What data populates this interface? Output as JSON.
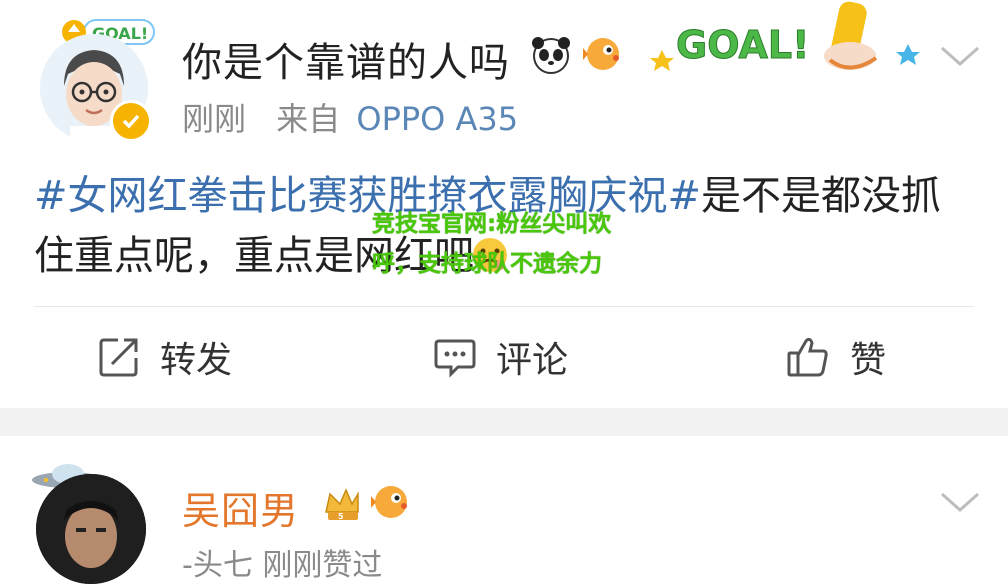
{
  "post": {
    "author_name": "你是个靠谱的人吗",
    "time": "刚刚",
    "source_prefix": "来自",
    "device": "OPPO A35",
    "goal_text": "GOAL!",
    "hashtag": "#女网红拳击比赛获胜撩衣露胸庆祝#",
    "body_text": "是不是都没抓住重点呢，重点是网红吧",
    "overlay_text": "竞技宝官网:粉丝尖叫欢呼，支持球队不遗余力"
  },
  "actions": {
    "repost_label": "转发",
    "comment_label": "评论",
    "like_label": "赞"
  },
  "comment": {
    "author_name": "吴囧男",
    "meta_text": "-头七 刚刚赞过"
  },
  "colors": {
    "hashtag": "#3b6fae",
    "comment_name": "#e3772b",
    "overlay_green": "#49c80a",
    "meta_gray": "#8a8a8a"
  }
}
